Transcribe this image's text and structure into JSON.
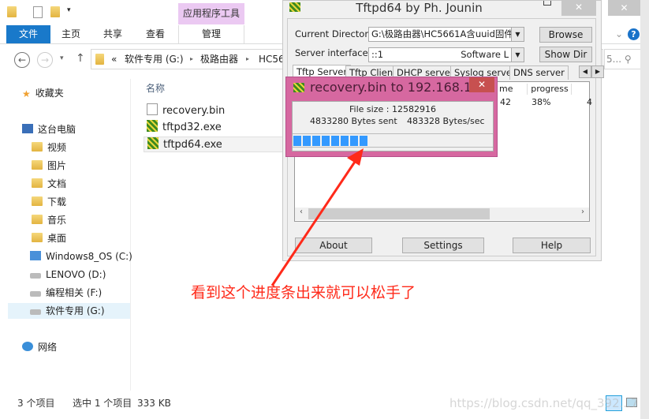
{
  "explorer": {
    "context_tab": "应用程序工具",
    "ribbon_tabs": [
      "文件",
      "主页",
      "共享",
      "查看",
      "管理"
    ],
    "breadcrumb": [
      "«",
      "软件专用 (G:)",
      "极路由器",
      "HC56"
    ],
    "search_partial": "5...",
    "nav": {
      "favorites": "收藏夹",
      "this_pc": "这台电脑",
      "items": [
        "视频",
        "图片",
        "文档",
        "下载",
        "音乐",
        "桌面",
        "Windows8_OS (C:)",
        "LENOVO (D:)",
        "编程相关 (F:)",
        "软件专用 (G:)"
      ],
      "network": "网络"
    },
    "column_header": "名称",
    "files": [
      "recovery.bin",
      "tftpd32.exe",
      "tftpd64.exe"
    ],
    "status": {
      "count": "3 个项目",
      "selected": "选中 1 个项目",
      "size": "333 KB"
    }
  },
  "tftpd": {
    "title": "Tftpd64 by Ph. Jounin",
    "current_directory_label": "Current Directory",
    "current_directory": "G:\\极路由器\\HC5661A含uuid固件\\",
    "server_interfaces_label": "Server interfaces",
    "server_interface": "::1",
    "server_interface_desc": "Software L",
    "browse": "Browse",
    "show_dir": "Show Dir",
    "tabs": [
      "Tftp Server",
      "Tftp Client",
      "DHCP server",
      "Syslog server",
      "DNS server"
    ],
    "columns": [
      "me",
      "progress"
    ],
    "row": {
      "time": "42",
      "progress": "38%",
      "extra": "4"
    },
    "buttons": {
      "about": "About",
      "settings": "Settings",
      "help": "Help"
    }
  },
  "transfer": {
    "title": "recovery.bin to 192.168.1...",
    "file_size": "File size : 12582916",
    "bytes_sent": "4833280 Bytes sent",
    "rate": "483328 Bytes/sec",
    "progress": 0.38,
    "accent": "#3399ff"
  },
  "annotation": "看到这个进度条出来就可以松手了",
  "watermark": "https://blog.csdn.net/qq_392...7"
}
